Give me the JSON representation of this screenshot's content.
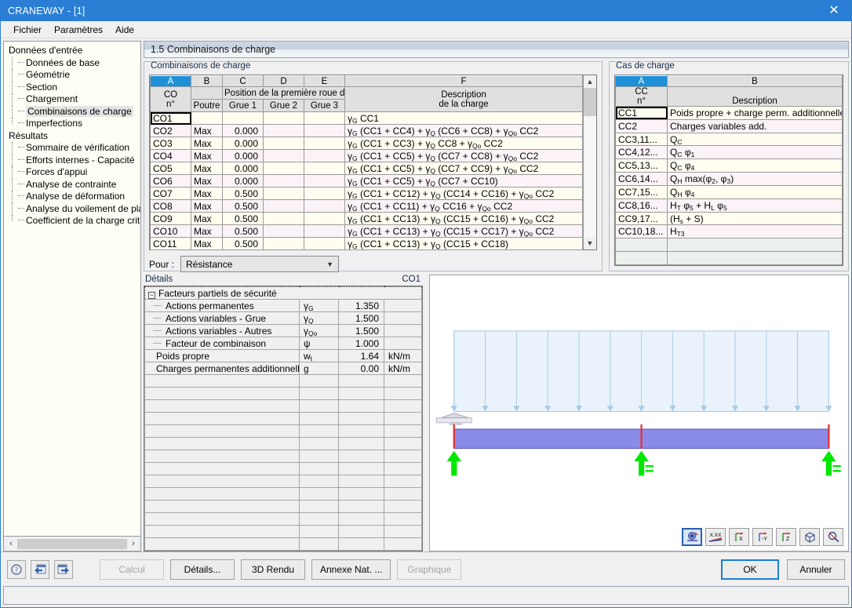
{
  "window": {
    "title": "CRANEWAY - [1]",
    "close_label": "✕"
  },
  "menu": {
    "items": [
      "Fichier",
      "Paramètres",
      "Aide"
    ]
  },
  "sidebar": {
    "groups": [
      {
        "label": "Données d'entrée",
        "items": [
          "Données de base",
          "Géométrie",
          "Section",
          "Chargement",
          "Combinaisons de charge",
          "Imperfections"
        ],
        "selected": "Combinaisons de charge"
      },
      {
        "label": "Résultats",
        "items": [
          "Sommaire de vérification",
          "Efforts internes - Capacité",
          "Forces d'appui",
          "Analyse de contrainte",
          "Analyse de déformation",
          "Analyse du voilement de plaque",
          "Coefficient de la charge critique"
        ],
        "selected": ""
      }
    ],
    "scroll_left": "‹",
    "scroll_right": "›"
  },
  "section": {
    "title": "1.5 Combinaisons de charge"
  },
  "combinations": {
    "group_label": "Combinaisons de charge",
    "columns": [
      "A",
      "B",
      "C",
      "D",
      "E",
      "F"
    ],
    "active_column": "A",
    "header_left_line1": "CO",
    "header_left_line2": "n°",
    "header_poutre": "Poutre",
    "header_span": "Position de la première roue de la",
    "header_grue1": "Grue 1",
    "header_grue2": "Grue 2",
    "header_grue3": "Grue 3",
    "header_desc_line1": "Description",
    "header_desc_line2": "de la charge",
    "rows": [
      {
        "co": "CO1",
        "poutre": "",
        "grue1": "",
        "grue2": "",
        "grue3": "",
        "desc_terms": [
          [
            "g",
            "G"
          ],
          [
            "t",
            " CC1"
          ]
        ]
      },
      {
        "co": "CO2",
        "poutre": "Max",
        "grue1": "0.000",
        "grue2": "",
        "grue3": "",
        "desc_terms": [
          [
            "g",
            "G"
          ],
          [
            "t",
            " (CC1 + CC4) + "
          ],
          [
            "g",
            "Q"
          ],
          [
            "t",
            " (CC6 + CC8) + "
          ],
          [
            "g",
            "Qo"
          ],
          [
            "t",
            " CC2"
          ]
        ]
      },
      {
        "co": "CO3",
        "poutre": "Max",
        "grue1": "0.000",
        "grue2": "",
        "grue3": "",
        "desc_terms": [
          [
            "g",
            "G"
          ],
          [
            "t",
            " (CC1 + CC3) + "
          ],
          [
            "g",
            "Q"
          ],
          [
            "t",
            " CC8 + "
          ],
          [
            "g",
            "Qo"
          ],
          [
            "t",
            " CC2"
          ]
        ]
      },
      {
        "co": "CO4",
        "poutre": "Max",
        "grue1": "0.000",
        "grue2": "",
        "grue3": "",
        "desc_terms": [
          [
            "g",
            "G"
          ],
          [
            "t",
            " (CC1 + CC5) + "
          ],
          [
            "g",
            "Q"
          ],
          [
            "t",
            " (CC7 + CC8) + "
          ],
          [
            "g",
            "Qo"
          ],
          [
            "t",
            " CC2"
          ]
        ]
      },
      {
        "co": "CO5",
        "poutre": "Max",
        "grue1": "0.000",
        "grue2": "",
        "grue3": "",
        "desc_terms": [
          [
            "g",
            "G"
          ],
          [
            "t",
            " (CC1 + CC5) + "
          ],
          [
            "g",
            "Q"
          ],
          [
            "t",
            " (CC7 + CC9) + "
          ],
          [
            "g",
            "Qo"
          ],
          [
            "t",
            " CC2"
          ]
        ]
      },
      {
        "co": "CO6",
        "poutre": "Max",
        "grue1": "0.000",
        "grue2": "",
        "grue3": "",
        "desc_terms": [
          [
            "g",
            "G"
          ],
          [
            "t",
            " (CC1 + CC5) + "
          ],
          [
            "g",
            "Q"
          ],
          [
            "t",
            " (CC7 + CC10)"
          ]
        ]
      },
      {
        "co": "CO7",
        "poutre": "Max",
        "grue1": "0.500",
        "grue2": "",
        "grue3": "",
        "desc_terms": [
          [
            "g",
            "G"
          ],
          [
            "t",
            " (CC1 + CC12) + "
          ],
          [
            "g",
            "Q"
          ],
          [
            "t",
            " (CC14 + CC16) + "
          ],
          [
            "g",
            "Qo"
          ],
          [
            "t",
            " CC2"
          ]
        ]
      },
      {
        "co": "CO8",
        "poutre": "Max",
        "grue1": "0.500",
        "grue2": "",
        "grue3": "",
        "desc_terms": [
          [
            "g",
            "G"
          ],
          [
            "t",
            " (CC1 + CC11) + "
          ],
          [
            "g",
            "Q"
          ],
          [
            "t",
            " CC16 + "
          ],
          [
            "g",
            "Qo"
          ],
          [
            "t",
            " CC2"
          ]
        ]
      },
      {
        "co": "CO9",
        "poutre": "Max",
        "grue1": "0.500",
        "grue2": "",
        "grue3": "",
        "desc_terms": [
          [
            "g",
            "G"
          ],
          [
            "t",
            " (CC1 + CC13) + "
          ],
          [
            "g",
            "Q"
          ],
          [
            "t",
            " (CC15 + CC16) + "
          ],
          [
            "g",
            "Qo"
          ],
          [
            "t",
            " CC2"
          ]
        ]
      },
      {
        "co": "CO10",
        "poutre": "Max",
        "grue1": "0.500",
        "grue2": "",
        "grue3": "",
        "desc_terms": [
          [
            "g",
            "G"
          ],
          [
            "t",
            " (CC1 + CC13) + "
          ],
          [
            "g",
            "Q"
          ],
          [
            "t",
            " (CC15 + CC17) + "
          ],
          [
            "g",
            "Qo"
          ],
          [
            "t",
            " CC2"
          ]
        ]
      },
      {
        "co": "CO11",
        "poutre": "Max",
        "grue1": "0.500",
        "grue2": "",
        "grue3": "",
        "desc_terms": [
          [
            "g",
            "G"
          ],
          [
            "t",
            " (CC1 + CC13) + "
          ],
          [
            "g",
            "Q"
          ],
          [
            "t",
            " (CC15 + CC18)"
          ]
        ]
      }
    ],
    "selected_row": "CO1",
    "pour_label": "Pour :",
    "pour_value": "Résistance"
  },
  "load_cases": {
    "group_label": "Cas de charge",
    "columns": [
      "A",
      "B"
    ],
    "active_column": "A",
    "header_left_line1": "CC",
    "header_left_line2": "n°",
    "header_desc": "Description",
    "rows": [
      {
        "cc": "CC1",
        "desc_terms": [
          [
            "t",
            "Poids propre + charge perm. additionnelle"
          ]
        ]
      },
      {
        "cc": "CC2",
        "desc_terms": [
          [
            "t",
            "Charges variables add."
          ]
        ]
      },
      {
        "cc": "CC3,11...",
        "desc_terms": [
          [
            "t",
            "Q"
          ],
          [
            "s",
            "C"
          ]
        ]
      },
      {
        "cc": "CC4,12...",
        "desc_terms": [
          [
            "t",
            "Q"
          ],
          [
            "s",
            "C"
          ],
          [
            "t",
            " φ"
          ],
          [
            "s",
            "1"
          ]
        ]
      },
      {
        "cc": "CC5,13...",
        "desc_terms": [
          [
            "t",
            "Q"
          ],
          [
            "s",
            "C"
          ],
          [
            "t",
            " φ"
          ],
          [
            "s",
            "4"
          ]
        ]
      },
      {
        "cc": "CC6,14...",
        "desc_terms": [
          [
            "t",
            "Q"
          ],
          [
            "s",
            "H"
          ],
          [
            "t",
            " max(φ"
          ],
          [
            "s",
            "2"
          ],
          [
            "t",
            ", φ"
          ],
          [
            "s",
            "3"
          ],
          [
            "t",
            ")"
          ]
        ]
      },
      {
        "cc": "CC7,15...",
        "desc_terms": [
          [
            "t",
            "Q"
          ],
          [
            "s",
            "H"
          ],
          [
            "t",
            " φ"
          ],
          [
            "s",
            "4"
          ]
        ]
      },
      {
        "cc": "CC8,16...",
        "desc_terms": [
          [
            "t",
            "H"
          ],
          [
            "s",
            "T"
          ],
          [
            "t",
            " φ"
          ],
          [
            "s",
            "5"
          ],
          [
            "t",
            " + H"
          ],
          [
            "s",
            "L"
          ],
          [
            "t",
            " φ"
          ],
          [
            "s",
            "5"
          ]
        ]
      },
      {
        "cc": "CC9,17...",
        "desc_terms": [
          [
            "t",
            "(H"
          ],
          [
            "s",
            "s"
          ],
          [
            "t",
            " + S)"
          ]
        ]
      },
      {
        "cc": "CC10,18...",
        "desc_terms": [
          [
            "t",
            "H"
          ],
          [
            "s",
            "T3"
          ]
        ]
      }
    ],
    "selected_row": "CC1"
  },
  "details": {
    "label": "Détails",
    "current_co": "CO1",
    "group_row": {
      "label": "Facteurs partiels de sécurité",
      "toggle": "−"
    },
    "rows": [
      {
        "indent": true,
        "label": "Actions permanentes",
        "sym_terms": [
          [
            "g",
            "G"
          ]
        ],
        "value": "1.350",
        "unit": ""
      },
      {
        "indent": true,
        "label": "Actions variables - Grue",
        "sym_terms": [
          [
            "g",
            "Q"
          ]
        ],
        "value": "1.500",
        "unit": ""
      },
      {
        "indent": true,
        "label": "Actions variables - Autres",
        "sym_terms": [
          [
            "g",
            "Qo"
          ]
        ],
        "value": "1.500",
        "unit": ""
      },
      {
        "indent": true,
        "label": "Facteur de combinaison",
        "sym_terms": [
          [
            "p",
            "ψ"
          ]
        ],
        "value": "1.000",
        "unit": ""
      },
      {
        "indent": false,
        "label": "Poids propre",
        "sym_terms": [
          [
            "p",
            "w"
          ],
          [
            "s",
            "t"
          ]
        ],
        "value": "1.64",
        "unit": "kN/m"
      },
      {
        "indent": false,
        "label": "Charges permanentes additionnelles",
        "sym_terms": [
          [
            "p",
            "g"
          ]
        ],
        "value": "0.00",
        "unit": "kN/m"
      }
    ],
    "empty_row_count": 14
  },
  "graphics": {
    "beam_color": "#8a8ae8",
    "load_color": "#a8cbe8",
    "support_color": "#00e800",
    "end_marker_color": "#e83030",
    "load_arrow_count": 13,
    "support_count": 3,
    "tools": [
      {
        "name": "render-model-icon",
        "label": "⚙",
        "selected": true
      },
      {
        "name": "values-xx-icon",
        "label": "X.XX",
        "selected": false
      },
      {
        "name": "view-x-axis-icon",
        "label": "X",
        "selected": false
      },
      {
        "name": "view-minus-y-icon",
        "label": "-Y",
        "selected": false
      },
      {
        "name": "view-z-axis-icon",
        "label": "Z",
        "selected": false
      },
      {
        "name": "view-3d-cube-icon",
        "label": "□",
        "selected": false
      },
      {
        "name": "zoom-icon",
        "label": "⌕",
        "selected": false
      }
    ]
  },
  "footer": {
    "help_icon": "?",
    "prev_icon": "◀",
    "next_icon": "▶",
    "buttons": [
      {
        "label": "Calcul",
        "disabled": true
      },
      {
        "label": "Détails...",
        "disabled": false
      },
      {
        "label": "3D Rendu",
        "disabled": false
      },
      {
        "label": "Annexe Nat. ...",
        "disabled": false
      },
      {
        "label": "Graphique",
        "disabled": true
      }
    ],
    "ok_label": "OK",
    "cancel_label": "Annuler"
  },
  "colors": {
    "accent": "#2a7fd4",
    "header_blue": "#1e90d8",
    "row_odd": "#fffdf0",
    "row_even": "#fbf3f7"
  }
}
